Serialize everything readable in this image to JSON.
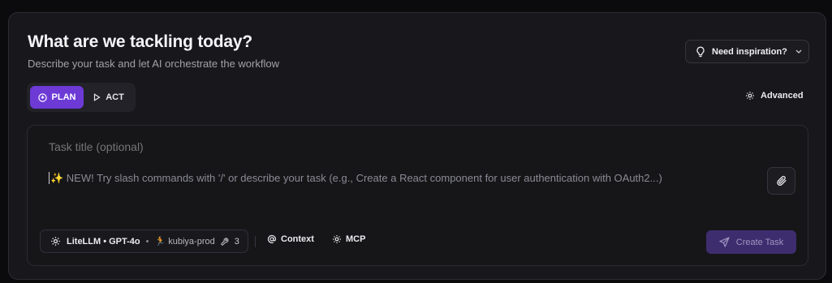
{
  "header": {
    "title": "What are we tackling today?",
    "subtitle": "Describe your task and let AI orchestrate the workflow"
  },
  "inspiration": {
    "label": "Need inspiration?",
    "icon": "lightbulb-icon"
  },
  "modes": [
    {
      "label": "PLAN",
      "active": true,
      "icon": "plan-icon"
    },
    {
      "label": "ACT",
      "active": false,
      "icon": "play-icon"
    }
  ],
  "advanced": {
    "label": "Advanced",
    "icon": "gear-icon"
  },
  "editor": {
    "title_placeholder": "Task title (optional)",
    "description_placeholder": "✨ NEW! Try slash commands with '/' or describe your task (e.g., Create a React component for user authentication with OAuth2...)"
  },
  "footer": {
    "model": "LiteLLM • GPT-4o",
    "separator": "•",
    "environment": "🏃 kubiya-prod",
    "tools_count": "3",
    "context_label": "Context",
    "mcp_label": "MCP",
    "create_label": "Create Task"
  },
  "colors": {
    "accent": "#6d3ad6",
    "create_button": "#3e2d6e",
    "panel": "#18181c"
  }
}
